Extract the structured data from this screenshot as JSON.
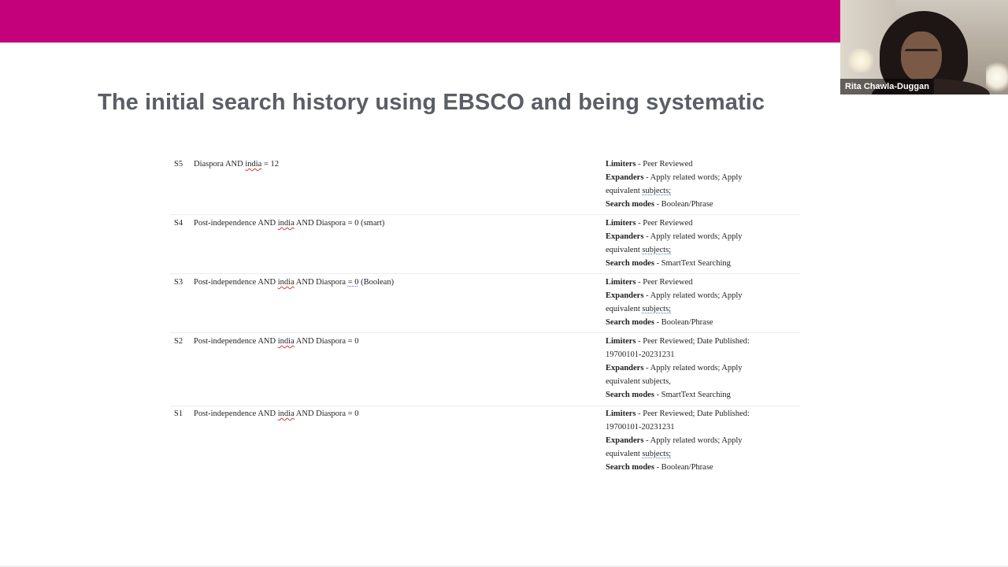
{
  "slide": {
    "title": "The initial search history using EBSCO and being systematic",
    "accent_color": "#c4007a",
    "title_color": "#5b5e66"
  },
  "video": {
    "participant_name": "Rita Chawla-Duggan"
  },
  "search_history": {
    "labels": {
      "limiters": "Limiters",
      "expanders": "Expanders",
      "search_modes": "Search modes"
    },
    "rows": [
      {
        "id": "S5",
        "query_pre": "Diaspora AND ",
        "query_word": "india",
        "query_post": " = 12",
        "limiters": " - Peer Reviewed",
        "expanders_pre": " - Apply related words; Apply equivalent ",
        "expanders_word": "subjects;",
        "search_modes": " - Boolean/Phrase"
      },
      {
        "id": "S4",
        "query_pre": "Post-independence AND ",
        "query_word": "india",
        "query_post": " AND Diaspora = 0 (smart)",
        "limiters": " - Peer Reviewed",
        "expanders_pre": " - Apply related words; Apply equivalent ",
        "expanders_word": "subjects;",
        "search_modes": " - SmartText Searching"
      },
      {
        "id": "S3",
        "query_pre": "Post-independence AND ",
        "query_word": "india",
        "query_mid": " AND Diaspora ",
        "query_eq": "=  0",
        "query_post": " (Boolean)",
        "limiters": " - Peer Reviewed",
        "expanders_pre": " - Apply related words; Apply equivalent ",
        "expanders_word": "subjects;",
        "search_modes": " - Boolean/Phrase"
      },
      {
        "id": "S2",
        "query_pre": "Post-independence AND ",
        "query_word": "india",
        "query_post": " AND Diaspora = 0",
        "limiters": " - Peer Reviewed; Date Published: 19700101-20231231",
        "expanders_pre": " - Apply related words; Apply equivalent ",
        "expanders_word": "subjects,",
        "search_modes": " - SmartText Searching"
      },
      {
        "id": "S1",
        "query_pre": "Post-independence AND ",
        "query_word": "india",
        "query_post": " AND Diaspora = 0",
        "limiters": " - Peer Reviewed; Date Published: 19700101-20231231",
        "expanders_pre": " - Apply related words; Apply equivalent ",
        "expanders_word": "subjects;",
        "search_modes": " - Boolean/Phrase"
      }
    ]
  }
}
